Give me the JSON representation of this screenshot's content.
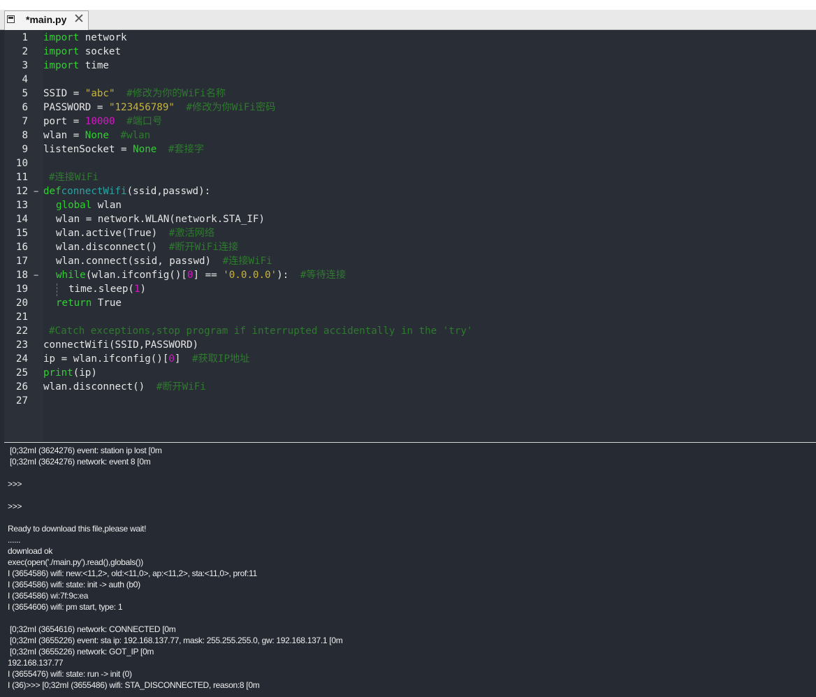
{
  "tab": {
    "title": "*main.py"
  },
  "editor": {
    "lines": [
      {
        "n": "1",
        "segs": [
          [
            "kw",
            "import"
          ],
          [
            "",
            "network"
          ]
        ]
      },
      {
        "n": "2",
        "segs": [
          [
            "kw",
            "import"
          ],
          [
            "",
            "socket"
          ]
        ]
      },
      {
        "n": "3",
        "segs": [
          [
            "kw",
            "import"
          ],
          [
            "",
            "time"
          ]
        ]
      },
      {
        "n": "4",
        "segs": []
      },
      {
        "n": "5",
        "segs": [
          [
            "",
            "SSID = "
          ],
          [
            "str",
            "\"abc\""
          ],
          [
            "",
            " "
          ],
          [
            "cm",
            "#修改为你的WiFi名称"
          ]
        ]
      },
      {
        "n": "6",
        "segs": [
          [
            "",
            "PASSWORD = "
          ],
          [
            "str",
            "\"123456789\""
          ],
          [
            "",
            " "
          ],
          [
            "cm",
            "#修改为你WiFi密码"
          ]
        ]
      },
      {
        "n": "7",
        "segs": [
          [
            "",
            "port = "
          ],
          [
            "num",
            "10000"
          ],
          [
            "",
            " "
          ],
          [
            "cm",
            "#端口号"
          ]
        ]
      },
      {
        "n": "8",
        "segs": [
          [
            "",
            "wlan = "
          ],
          [
            "kw",
            "None"
          ],
          [
            "",
            " "
          ],
          [
            "cm",
            "#wlan"
          ]
        ]
      },
      {
        "n": "9",
        "segs": [
          [
            "",
            "listenSocket = "
          ],
          [
            "kw",
            "None"
          ],
          [
            "",
            " "
          ],
          [
            "cm",
            "#套接字"
          ]
        ]
      },
      {
        "n": "10",
        "segs": []
      },
      {
        "n": "11",
        "segs": [
          [
            "cm",
            "#连接WiFi"
          ]
        ]
      },
      {
        "n": "12",
        "fold": true,
        "segs": [
          [
            "kw",
            "def"
          ],
          [
            "fn",
            "connectWifi"
          ],
          [
            "",
            "(ssid,passwd):"
          ]
        ]
      },
      {
        "n": "13",
        "segs": [
          [
            "kw",
            "global"
          ],
          [
            "",
            "wlan"
          ]
        ]
      },
      {
        "n": "14",
        "segs": [
          [
            "",
            "wlan = network.WLAN(network.STA_IF)"
          ]
        ]
      },
      {
        "n": "15",
        "segs": [
          [
            "",
            "wlan.active(True)"
          ],
          [
            "",
            " "
          ],
          [
            "cm",
            "#激活网络"
          ]
        ]
      },
      {
        "n": "16",
        "segs": [
          [
            "",
            "wlan.disconnect()"
          ],
          [
            "",
            " "
          ],
          [
            "cm",
            "#断开WiFi连接"
          ]
        ]
      },
      {
        "n": "17",
        "segs": [
          [
            "",
            "wlan.connect(ssid, passwd)"
          ],
          [
            "",
            " "
          ],
          [
            "cm",
            "#连接WiFi"
          ]
        ]
      },
      {
        "n": "18",
        "fold": true,
        "segs": [
          [
            "kw",
            "while"
          ],
          [
            "",
            "(wlan.ifconfig()["
          ],
          [
            "num",
            "0"
          ],
          [
            "",
            "] == "
          ],
          [
            "str",
            "'0.0.0.0'"
          ],
          [
            "",
            "):"
          ],
          [
            "",
            " "
          ],
          [
            "cm",
            "#等待连接"
          ]
        ]
      },
      {
        "n": "19",
        "segs": [
          [
            "",
            "time.sleep("
          ],
          [
            "num",
            "1"
          ],
          [
            "",
            ")"
          ]
        ]
      },
      {
        "n": "20",
        "segs": [
          [
            "kw",
            "return"
          ],
          [
            "",
            " True"
          ]
        ]
      },
      {
        "n": "21",
        "segs": []
      },
      {
        "n": "22",
        "segs": [
          [
            "cm",
            "#Catch exceptions,stop program if interrupted accidentally in the 'try'"
          ]
        ]
      },
      {
        "n": "23",
        "segs": [
          [
            "",
            "connectWifi(SSID,PASSWORD)"
          ]
        ]
      },
      {
        "n": "24",
        "segs": [
          [
            "",
            "ip = wlan.ifconfig()["
          ],
          [
            "num",
            "0"
          ],
          [
            "",
            "]"
          ],
          [
            "",
            " "
          ],
          [
            "cm",
            "#获取IP地址"
          ]
        ]
      },
      {
        "n": "25",
        "segs": [
          [
            "kw",
            "print"
          ],
          [
            "",
            "(ip)"
          ]
        ]
      },
      {
        "n": "26",
        "segs": [
          [
            "",
            "wlan.disconnect()"
          ],
          [
            "",
            " "
          ],
          [
            "cm",
            "#断开WiFi"
          ]
        ]
      },
      {
        "n": "27",
        "segs": []
      }
    ]
  },
  "console": {
    "lines": [
      "[0;32mI (3624276) event: station ip lost [0m",
      "[0;32mI (3624276) network: event 8 [0m",
      "",
      ">>>",
      "",
      ">>>",
      "",
      "Ready to download this file,please wait!",
      "......",
      "download ok",
      "exec(open('./main.py').read(),globals())",
      "I (3654586) wifi: new:<11,2>, old:<11,0>, ap:<11,2>, sta:<11,0>, prof:11",
      "I (3654586) wifi: state: init -> auth (b0)",
      "I (3654586) wi:7f:9c:ea",
      "I (3654606) wifi: pm start, type: 1",
      "",
      "[0;32mI (3654616) network: CONNECTED [0m",
      "[0;32mI (3655226) event: sta ip: 192.168.137.77, mask: 255.255.255.0, gw: 192.168.137.1 [0m",
      "[0;32mI (3655226) network: GOT_IP [0m",
      "192.168.137.77",
      "I (3655476) wifi: state: run -> init (0)",
      "I (36)>>> [0;32mI (3655486) wifi: STA_DISCONNECTED, reason:8 [0m"
    ]
  }
}
